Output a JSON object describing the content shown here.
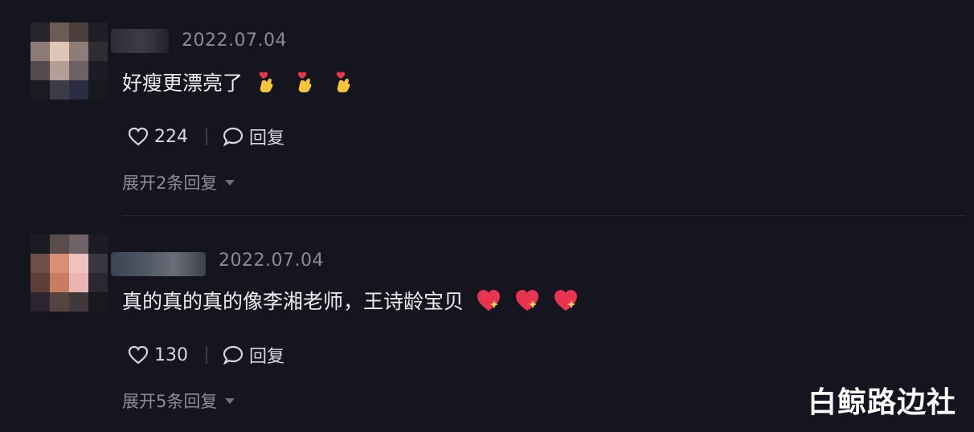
{
  "comments": [
    {
      "date": "2022.07.04",
      "text": "好瘦更漂亮了",
      "emoji": "finger-heart-icon",
      "likes": "224",
      "reply_label": "回复",
      "expand_label": "展开2条回复"
    },
    {
      "date": "2022.07.04",
      "text": "真的真的真的像李湘老师，王诗龄宝贝",
      "emoji": "sparkling-heart-icon",
      "likes": "130",
      "reply_label": "回复",
      "expand_label": "展开5条回复"
    }
  ],
  "watermark": "白鲸路边社",
  "colors": {
    "background": "#15151f",
    "text": "#eeeeee",
    "muted": "#8a8b93",
    "heart": "#e8344e"
  }
}
